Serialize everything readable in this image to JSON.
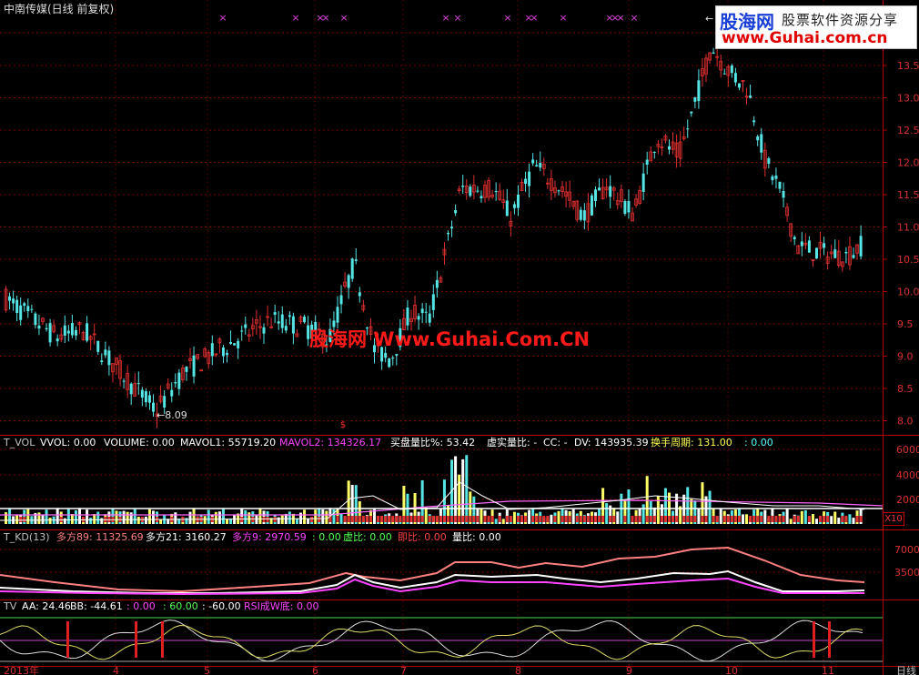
{
  "title": "中南传媒(日线 前复权)",
  "logo": {
    "brand": "股海网",
    "tagline": "股票软件资源分享",
    "url": "www.Guhai.com.cn"
  },
  "watermark": "股海网 Www.Guhai.Com.CN",
  "price_axis": {
    "labels": [
      "13.5",
      "13.0",
      "12.5",
      "12.0",
      "11.5",
      "11.0",
      "10.5",
      "10.0",
      "9.5",
      "9.0",
      "8.5",
      "8.0"
    ]
  },
  "low_marker": "8.09",
  "vol_panel": {
    "header": [
      {
        "t": "T_VOL",
        "c": "#c0c0c0"
      },
      {
        "t": "VVOL: 0.00",
        "c": "#ffffff"
      },
      {
        "t": "VOLUME: 0.00",
        "c": "#ffffff"
      },
      {
        "t": "MAVOL1: 55719.20",
        "c": "#ffffff"
      },
      {
        "t": "MAVOL2: 134326.17",
        "c": "#ff44ff"
      },
      {
        "t": "买盘量比%: 53.42",
        "c": "#ffffff"
      },
      {
        "t": "虚实量比: -",
        "c": "#ffffff"
      },
      {
        "t": "CC: -",
        "c": "#ffffff"
      },
      {
        "t": "DV: 143935.39",
        "c": "#ffffff"
      },
      {
        "t": "换手周期: 131.00",
        "c": "#ffff55"
      },
      {
        "t": ": 0.00",
        "c": "#55ffff"
      }
    ],
    "axis": [
      "6000",
      "4000",
      "2000"
    ],
    "scale_tag": "X10"
  },
  "kd_panel": {
    "header": [
      {
        "t": "T_KD(13)",
        "c": "#c0c0c0"
      },
      {
        "t": "多方89: 11325.69",
        "c": "#ff8080"
      },
      {
        "t": "多方21: 3160.27",
        "c": "#ffffff"
      },
      {
        "t": "多方9: 2970.59",
        "c": "#ff44ff"
      },
      {
        "t": ": 0.00",
        "c": "#55ff55"
      },
      {
        "t": "虚比: 0.00",
        "c": "#55ff55"
      },
      {
        "t": "即比: 0.00",
        "c": "#ff4444"
      },
      {
        "t": "量比: 0.00",
        "c": "#ffffff"
      }
    ],
    "axis": [
      "7000",
      "3500"
    ]
  },
  "tv_panel": {
    "header": [
      {
        "t": "TV",
        "c": "#c0c0c0"
      },
      {
        "t": "AA: 24.46",
        "c": "#ffffff"
      },
      {
        "t": "BB: -44.61",
        "c": "#ffffff"
      },
      {
        "t": ": 0.00",
        "c": "#ff44ff"
      },
      {
        "t": ": 60.00",
        "c": "#55ff55"
      },
      {
        "t": ": -60.00",
        "c": "#ffffff"
      },
      {
        "t": "RSI成W底: 0.00",
        "c": "#ff44ff"
      }
    ]
  },
  "date_axis": {
    "labels": [
      "2013年",
      "4",
      "5",
      "6",
      "7",
      "8",
      "9",
      "10",
      "11"
    ],
    "period": "日线"
  },
  "colors": {
    "up": "#e03030",
    "down": "#55e5e5",
    "grid": "#7a0000",
    "axis": "#b00000"
  }
}
